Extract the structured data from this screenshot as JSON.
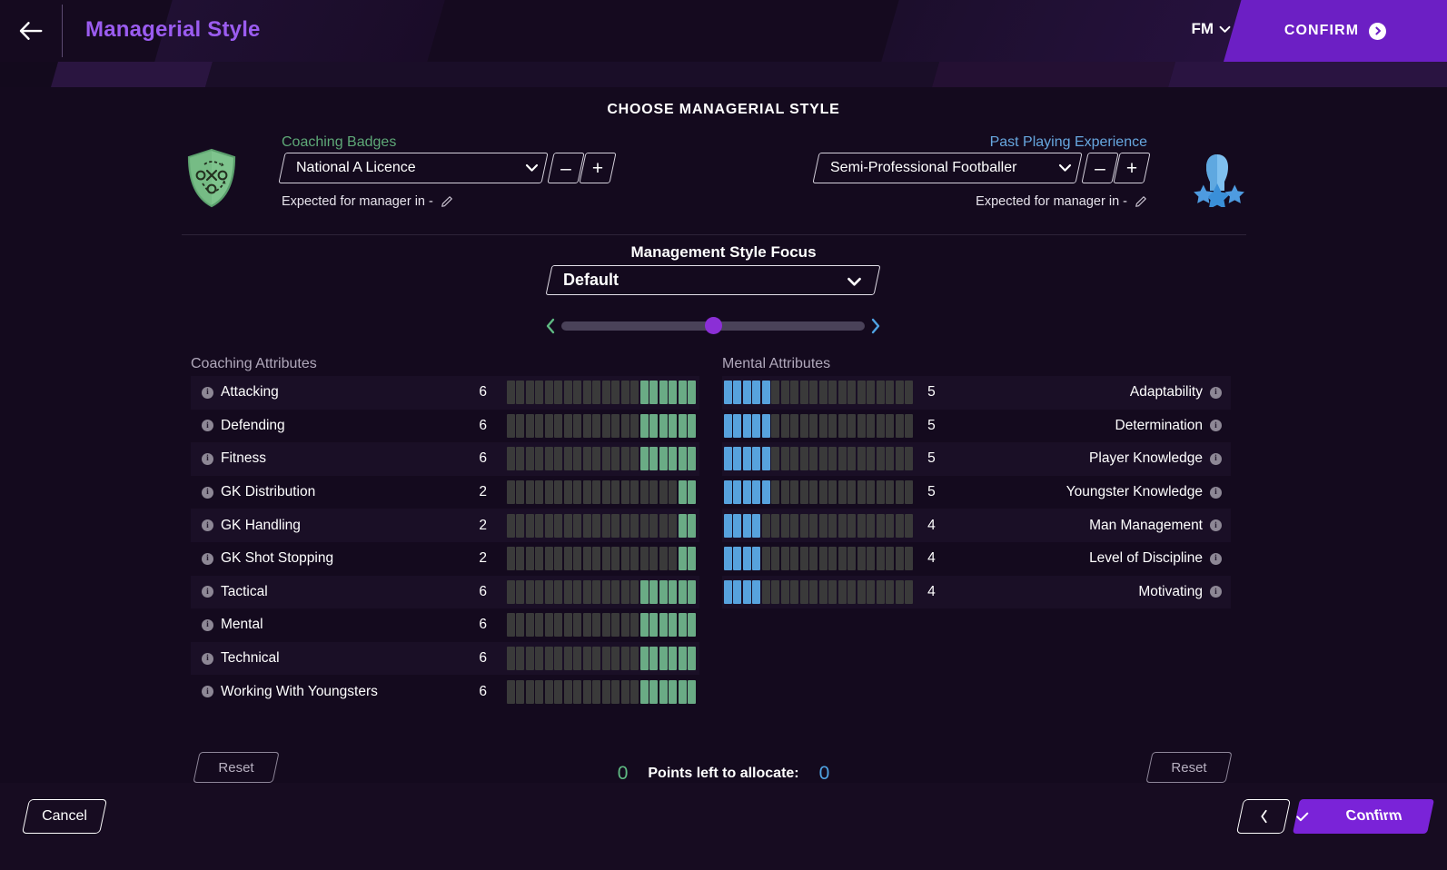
{
  "topbar": {
    "back_icon": "arrow-left-icon",
    "title": "Managerial Style",
    "fm_label": "FM",
    "fm_chevron_icon": "chevron-down-icon",
    "confirm_label": "CONFIRM",
    "confirm_arrow_icon": "circle-arrow-right-icon",
    "accent": "#6c1fc4"
  },
  "page": {
    "heading": "CHOOSE MANAGERIAL STYLE"
  },
  "coaching_badges": {
    "label": "Coaching Badges",
    "label_color": "#5ea877",
    "icon": "shield-tactics-icon",
    "selected": "National A Licence",
    "chevron_icon": "chevron-down-icon",
    "minus_label": "–",
    "plus_label": "+",
    "expected_text": "Expected for manager in  -",
    "edit_icon": "pencil-icon"
  },
  "past_playing": {
    "label": "Past Playing Experience",
    "label_color": "#67a7df",
    "icon": "player-stars-icon",
    "selected": "Semi-Professional Footballer",
    "chevron_icon": "chevron-down-icon",
    "minus_label": "–",
    "plus_label": "+",
    "expected_text": "Expected for manager in  -",
    "edit_icon": "pencil-icon"
  },
  "focus": {
    "title": "Management Style Focus",
    "selected": "Default",
    "chevron_icon": "chevron-down-icon",
    "slider": {
      "left_arrow_icon": "chevron-left-icon",
      "right_arrow_icon": "chevron-right-icon",
      "left_arrow_color": "#5fba83",
      "right_arrow_color": "#4fa3e3",
      "thumb_color": "#8b2fd6",
      "value_percent": 50
    }
  },
  "coaching_attributes": {
    "title": "Coaching Attributes",
    "max": 20,
    "bar_color": "#6aab85",
    "info_icon": "info-icon",
    "rows": [
      {
        "name": "Attacking",
        "value": 6
      },
      {
        "name": "Defending",
        "value": 6
      },
      {
        "name": "Fitness",
        "value": 6
      },
      {
        "name": "GK Distribution",
        "value": 2
      },
      {
        "name": "GK Handling",
        "value": 2
      },
      {
        "name": "GK Shot Stopping",
        "value": 2
      },
      {
        "name": "Tactical",
        "value": 6
      },
      {
        "name": "Mental",
        "value": 6
      },
      {
        "name": "Technical",
        "value": 6
      },
      {
        "name": "Working With Youngsters",
        "value": 6
      }
    ]
  },
  "mental_attributes": {
    "title": "Mental Attributes",
    "max": 20,
    "bar_color": "#57a2dd",
    "info_icon": "info-icon",
    "rows": [
      {
        "name": "Adaptability",
        "value": 5
      },
      {
        "name": "Determination",
        "value": 5
      },
      {
        "name": "Player Knowledge",
        "value": 5
      },
      {
        "name": "Youngster Knowledge",
        "value": 5
      },
      {
        "name": "Man Management",
        "value": 4
      },
      {
        "name": "Level of Discipline",
        "value": 4
      },
      {
        "name": "Motivating",
        "value": 4
      }
    ]
  },
  "footer_allocation": {
    "reset_left_label": "Reset",
    "reset_right_label": "Reset",
    "points_left_value": "0",
    "points_label": "Points left to allocate:",
    "points_right_value": "0"
  },
  "bottombar": {
    "cancel_label": "Cancel",
    "prev_icon": "chevron-left-icon",
    "confirm_label": "Confirm",
    "confirm_check_icon": "check-icon",
    "confirm_color": "#7a23d8"
  }
}
